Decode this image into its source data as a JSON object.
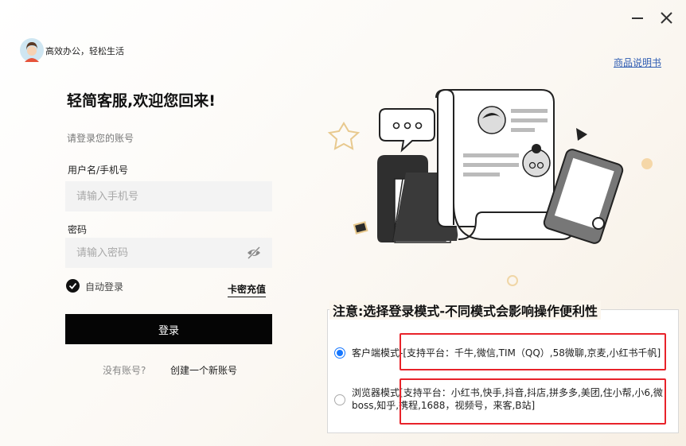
{
  "header": {
    "tagline": "高效办公，轻松生活",
    "manual_link": "商品说明书"
  },
  "window": {
    "minimize_symbol": "—",
    "close_symbol": "✕"
  },
  "login": {
    "welcome": "轻简客服,欢迎您回来!",
    "subtitle": "请登录您的账号",
    "username_label": "用户名/手机号",
    "username_placeholder": "请输入手机号",
    "password_label": "密码",
    "password_placeholder": "请输入密码",
    "auto_login": "自动登录",
    "auto_login_checked": true,
    "card_recharge": "卡密充值",
    "login_button": "登录",
    "no_account": "没有账号?",
    "create_account": "创建一个新账号"
  },
  "mode": {
    "title": "注意:选择登录模式-不同模式会影响操作便利性",
    "client_label": "客户端模式",
    "client_platforms": "-[支持平台：千牛,微信,TIM（QQ）,58微聊,京麦,小红书千帆]",
    "client_selected": true,
    "browser_label": "浏览器模式",
    "browser_platforms_line1": "[支持平台：小红书,快手,抖音,抖店,拼多多,美团,住小帮,小6,微",
    "browser_platforms_line2": "boss,知乎,携程,1688，视频号，来客,B站]",
    "browser_selected": false
  },
  "colors": {
    "accent": "#1677ff",
    "highlight_border": "#e8232a",
    "button_bg": "#050505"
  }
}
